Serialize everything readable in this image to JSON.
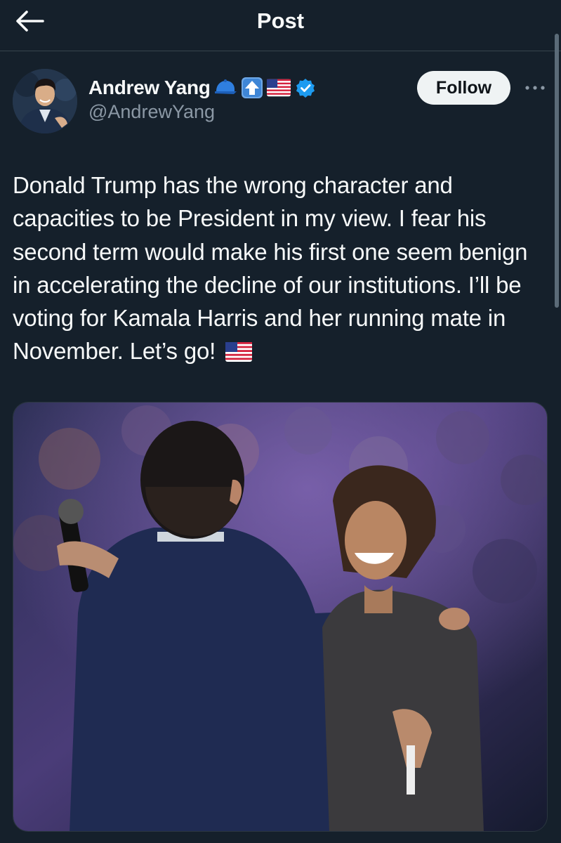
{
  "header": {
    "title": "Post",
    "back_icon": "arrow-left-icon"
  },
  "author": {
    "name": "Andrew Yang",
    "handle": "@AndrewYang",
    "badges": [
      "blue-cap-emoji",
      "up-arrow-emoji",
      "us-flag-emoji",
      "verified-badge-icon"
    ],
    "follow_label": "Follow",
    "more_icon": "ellipsis-icon"
  },
  "post": {
    "text": "Donald Trump has the wrong character and capacities to be President in my view. I fear his second term would make his first one seem benign in accelerating the decline of our institutions. I’ll be voting for Kamala Harris and her running mate in November. Let’s go!",
    "trailing_emoji": "us-flag-emoji"
  },
  "colors": {
    "background": "#15202b",
    "text": "#f7f9f9",
    "secondary_text": "#8b98a5",
    "verified": "#1d9bf0",
    "follow_bg": "#eff3f4"
  }
}
